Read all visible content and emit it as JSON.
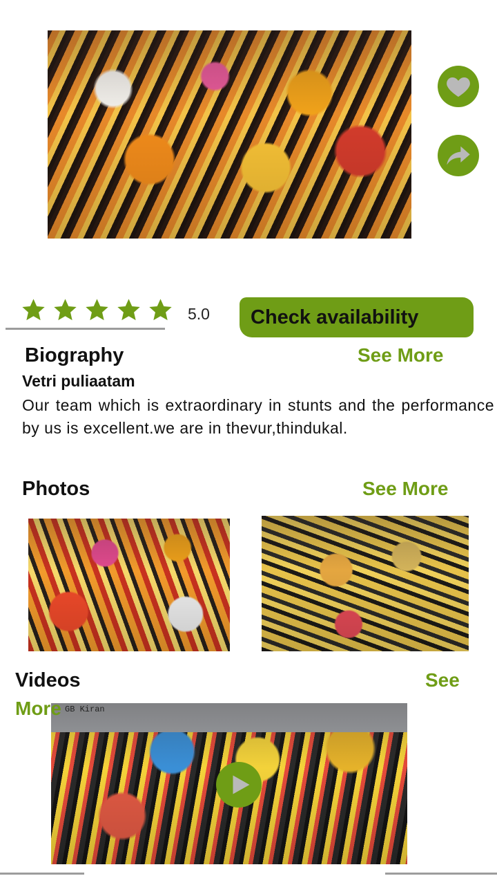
{
  "rating": {
    "value": "5.0",
    "stars": 5
  },
  "actions": {
    "check_availability": "Check availability"
  },
  "biography": {
    "title": "Biography",
    "see_more": "See More",
    "name": "Vetri puliaatam",
    "text": "Our team which is extraordinary in stunts and the performance by us is excellent.we are in thevur,thindukal."
  },
  "photos": {
    "title": "Photos",
    "see_more": "See More"
  },
  "videos": {
    "title": "Videos",
    "see_more_1": "See",
    "see_more_2": "More",
    "watermark": "GB Kiran"
  },
  "colors": {
    "accent": "#6f9d16",
    "text": "#111111"
  },
  "icons": {
    "favorite": "heart-icon",
    "share": "share-icon",
    "play": "play-icon",
    "star": "star-icon"
  }
}
